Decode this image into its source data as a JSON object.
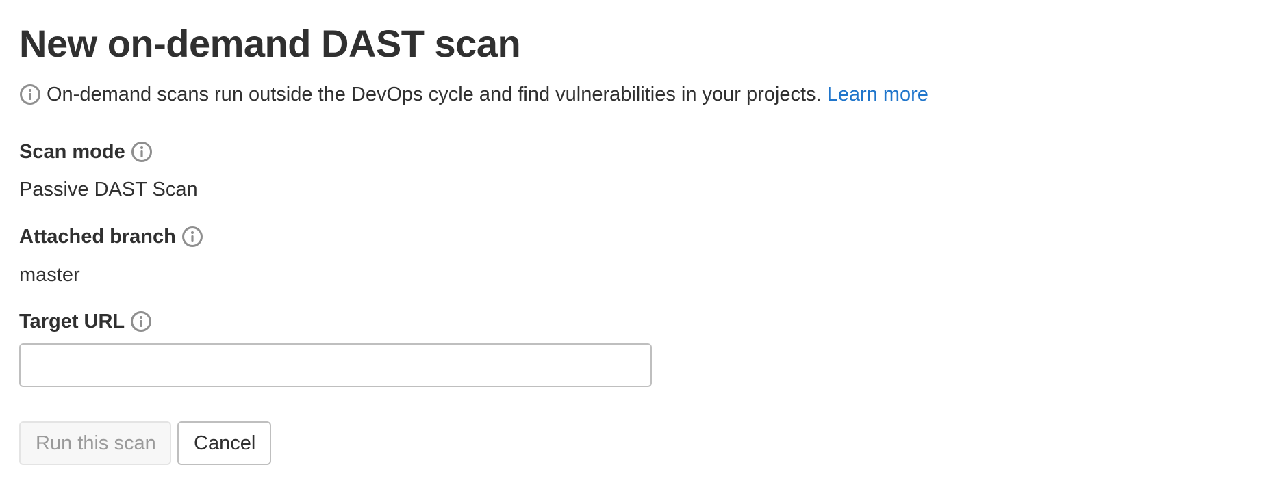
{
  "page": {
    "title": "New on-demand DAST scan",
    "description": "On-demand scans run outside the DevOps cycle and find vulnerabilities in your projects.",
    "learn_more_label": "Learn more"
  },
  "fields": {
    "scan_mode": {
      "label": "Scan mode",
      "value": "Passive DAST Scan"
    },
    "attached_branch": {
      "label": "Attached branch",
      "value": "master"
    },
    "target_url": {
      "label": "Target URL",
      "value": "",
      "placeholder": ""
    }
  },
  "actions": {
    "run_label": "Run this scan",
    "cancel_label": "Cancel"
  },
  "icons": {
    "info": "information-o-icon"
  },
  "colors": {
    "text": "#303030",
    "link": "#1f75cb",
    "icon": "#8f8f8f",
    "border": "#bfbfbf",
    "disabled_text": "#9a9a9a"
  }
}
